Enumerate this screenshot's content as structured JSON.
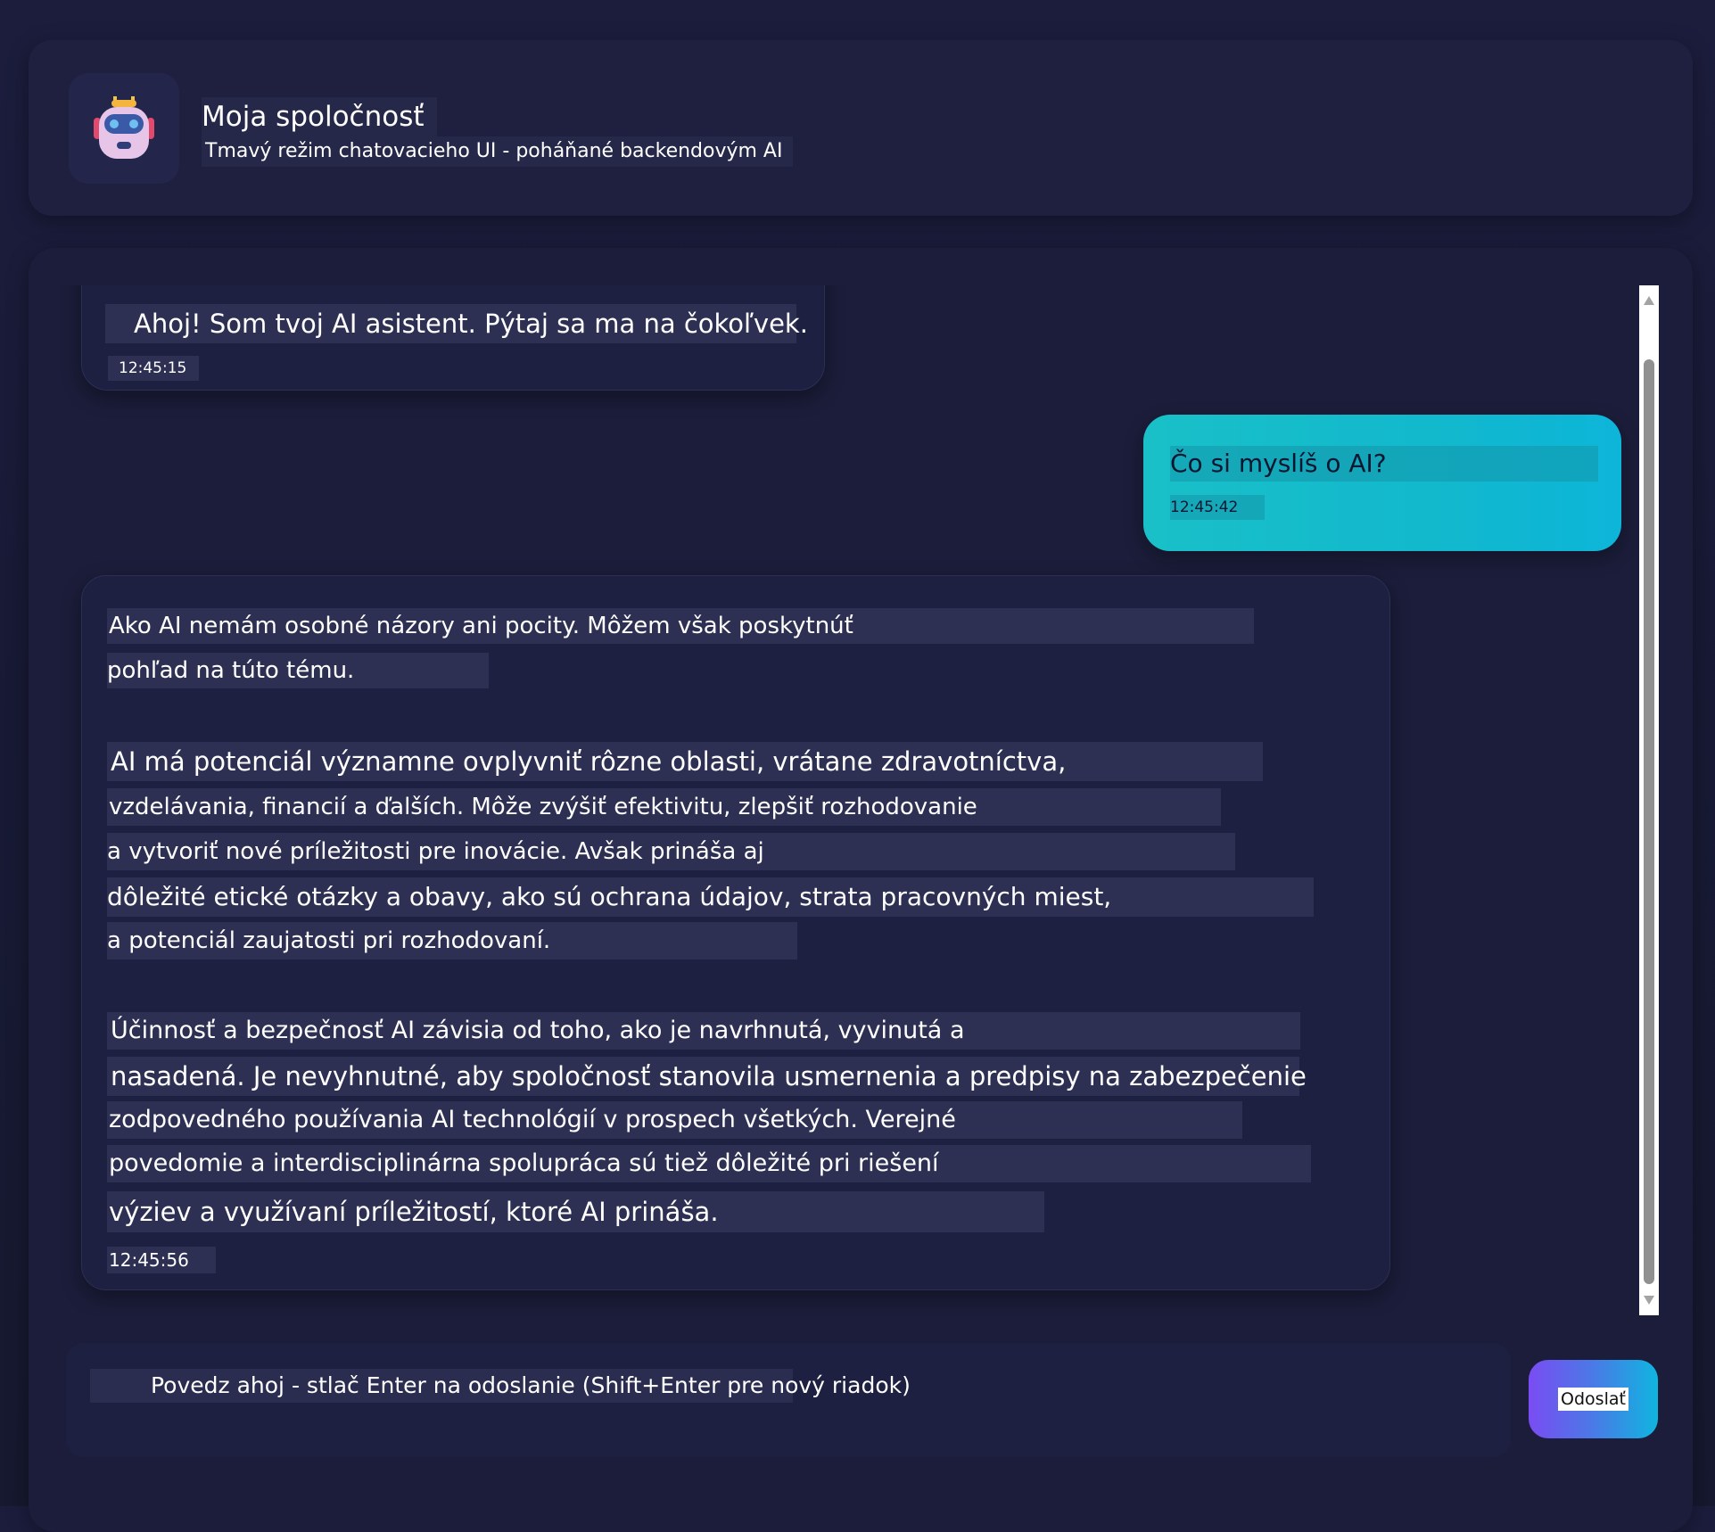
{
  "header": {
    "title": "Moja spoločnosť",
    "subtitle": "Tmavý režim chatovacieho UI - poháňané backendovým AI",
    "avatar_icon": "robot-icon"
  },
  "messages": [
    {
      "role": "assistant",
      "lines": [
        "Ahoj! Som tvoj AI asistent. Pýtaj sa ma na čokoľvek."
      ],
      "time": "12:45:15"
    },
    {
      "role": "user",
      "lines": [
        "Čo si myslíš o AI?"
      ],
      "time": "12:45:42"
    },
    {
      "role": "assistant",
      "lines": [
        "Ako AI nemám osobné názory ani pocity. Môžem však poskytnúť",
        "pohľad na túto tému.",
        "AI má potenciál významne ovplyvniť rôzne oblasti, vrátane zdravotníctva,",
        "vzdelávania, financií a ďalších. Môže zvýšiť efektivitu, zlepšiť rozhodovanie",
        "a vytvoriť nové príležitosti pre inovácie. Avšak prináša aj",
        "dôležité etické otázky a obavy, ako sú ochrana údajov, strata pracovných miest,",
        "a potenciál zaujatosti pri rozhodovaní.",
        "Účinnosť a bezpečnosť AI závisia od toho, ako je navrhnutá, vyvinutá a",
        "nasadená. Je nevyhnutné, aby spoločnosť stanovila usmernenia a predpisy na zabezpečenie",
        "zodpovedného používania AI technológií v prospech všetkých. Verejné",
        "povedomie a interdisciplinárna spolupráca sú tiež dôležité pri riešení",
        "výziev a využívaní príležitostí, ktoré AI prináša."
      ],
      "time": "12:45:56"
    }
  ],
  "input": {
    "placeholder": "Povedz ahoj - stlač Enter na odoslanie (Shift+Enter pre nový riadok)"
  },
  "send_button": {
    "label": "Odoslať"
  },
  "colors": {
    "background": "#1c1d3d",
    "user_bubble": "#12b8cc",
    "send_gradient_start": "#7a4cf3",
    "send_gradient_end": "#0fb5e0"
  }
}
